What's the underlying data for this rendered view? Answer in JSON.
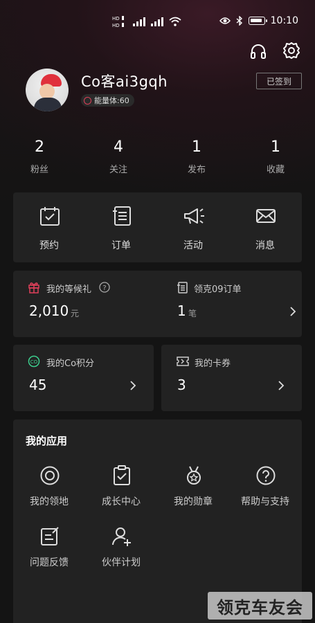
{
  "status_bar": {
    "network_left": "HD 1 4G",
    "network_right": "HD 2 4G",
    "time": "10:10"
  },
  "header_icons": [
    "headphones-icon",
    "gear-icon"
  ],
  "profile": {
    "username": "Co客ai3gqh",
    "energy_label": "能量体:60",
    "checkin_label": "已签到"
  },
  "stats": [
    {
      "value": "2",
      "label": "粉丝"
    },
    {
      "value": "4",
      "label": "关注"
    },
    {
      "value": "1",
      "label": "发布"
    },
    {
      "value": "1",
      "label": "收藏"
    }
  ],
  "quick_actions": [
    {
      "label": "预约",
      "icon": "calendar-check-icon"
    },
    {
      "label": "订单",
      "icon": "order-list-icon"
    },
    {
      "label": "活动",
      "icon": "megaphone-icon"
    },
    {
      "label": "消息",
      "icon": "mail-icon"
    }
  ],
  "gift": {
    "title": "我的等候礼",
    "value": "2,010",
    "unit": "元"
  },
  "order09": {
    "title": "领克09订单",
    "value": "1",
    "unit": "笔"
  },
  "points": {
    "title": "我的Co积分",
    "value": "45"
  },
  "coupons": {
    "title": "我的卡券",
    "value": "3"
  },
  "apps": {
    "title": "我的应用",
    "items": [
      {
        "label": "我的领地",
        "icon": "territory-icon"
      },
      {
        "label": "成长中心",
        "icon": "growth-clipboard-icon"
      },
      {
        "label": "我的勋章",
        "icon": "medal-icon"
      },
      {
        "label": "帮助与支持",
        "icon": "help-icon"
      },
      {
        "label": "问题反馈",
        "icon": "feedback-icon"
      },
      {
        "label": "伙伴计划",
        "icon": "add-partner-icon"
      }
    ]
  },
  "watermark": "领克车友会",
  "colors": {
    "accent_red": "#e0405a",
    "card_bg": "#222222",
    "points_green": "#3ccf8e"
  }
}
